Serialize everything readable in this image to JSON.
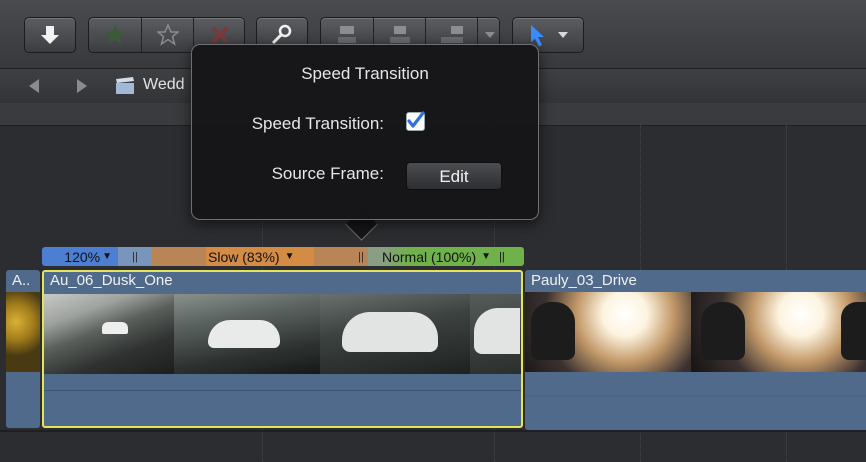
{
  "toolbar": {
    "import_icon": "download-arrow-icon",
    "rating_icons": [
      "favorite-star-icon",
      "unrate-star-icon",
      "reject-x-icon"
    ],
    "keyword_icon": "key-icon",
    "edit_icons": [
      "connect-clip-icon",
      "insert-clip-icon",
      "append-clip-icon"
    ],
    "tool_icon": "arrow-pointer-icon"
  },
  "navbar": {
    "project_name": "Wedd"
  },
  "retime_bar": {
    "segments": [
      {
        "label": "120%",
        "color": "#4c7fd1"
      },
      {
        "label": "",
        "color": "#5f86bb"
      },
      {
        "label": "Slow (83%)",
        "color": "#d48b43"
      },
      {
        "label": "",
        "color": "#b98456"
      },
      {
        "label": "Normal (100%)",
        "color": "#6fb14a"
      }
    ]
  },
  "clips": [
    {
      "name": "A.."
    },
    {
      "name": "Au_06_Dusk_One",
      "selected": true
    },
    {
      "name": "Pauly_03_Drive"
    }
  ],
  "popover": {
    "title": "Speed Transition",
    "speed_transition_label": "Speed Transition:",
    "speed_transition_checked": true,
    "source_frame_label": "Source Frame:",
    "edit_button": "Edit"
  },
  "colors": {
    "accent_blue": "#3b8cff",
    "selection_yellow": "#e6e35a",
    "clip_blue": "#506a8c"
  }
}
